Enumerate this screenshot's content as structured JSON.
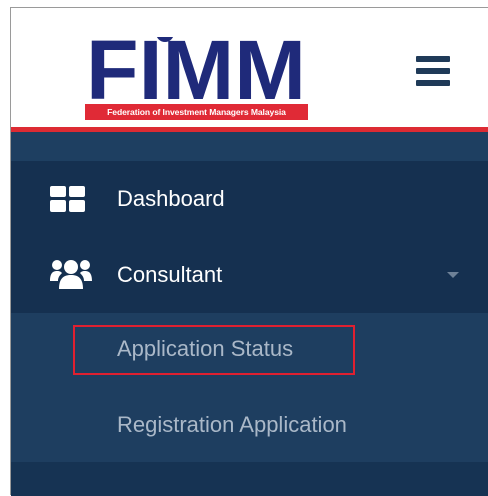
{
  "brand": {
    "logo_word": "FIMM",
    "tagline": "Federation of Investment Managers Malaysia",
    "colors": {
      "navy": "#1f2a7a",
      "red": "#e02a36"
    }
  },
  "header": {
    "menu_icon": "hamburger-menu-icon"
  },
  "nav": {
    "items": [
      {
        "label": "Dashboard",
        "icon": "dashboard-grid-icon"
      },
      {
        "label": "Consultant",
        "icon": "users-group-icon",
        "expanded": true,
        "indicator": "caret-down-icon"
      }
    ],
    "consultant_submenu": [
      {
        "label": "Application Status",
        "highlighted": true
      },
      {
        "label": "Registration Application"
      }
    ]
  },
  "colors": {
    "sidebar_bg": "#1e3e60",
    "item_bg": "#153050",
    "header_accent": "#dd2b33",
    "highlight_border": "#e02030",
    "submenu_text": "#aab8c8"
  }
}
